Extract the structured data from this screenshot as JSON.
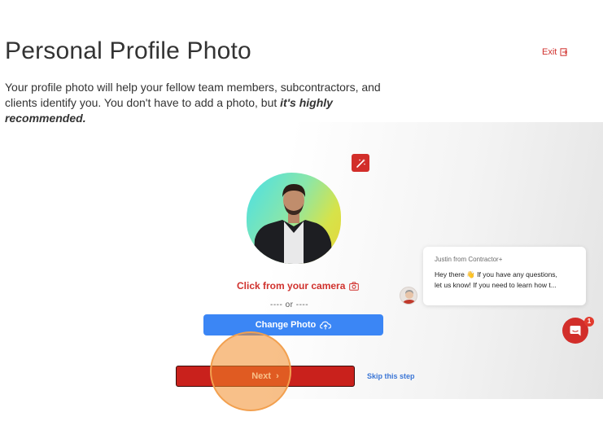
{
  "header": {
    "title": "Personal Profile Photo",
    "exit_label": "Exit"
  },
  "intro": {
    "text": "Your profile photo will help your fellow team members, subcontractors, and clients identify you. You don't have to add a photo, but ",
    "emphasis": "it's highly recommended."
  },
  "photo": {
    "edit_icon": "magic-wand-icon"
  },
  "actions": {
    "camera_label": "Click from your camera",
    "or_divider": "---- or ----",
    "change_photo_label": "Change Photo",
    "next_label": "Next",
    "skip_label": "Skip this step"
  },
  "chat": {
    "from": "Justin from Contractor+",
    "message_line1": "Hey there 👋 If you have any questions,",
    "message_line2": "let us know! If you need to learn how t...",
    "badge_count": "1"
  },
  "colors": {
    "brand_red": "#d0312d",
    "primary_blue": "#3b86f5",
    "next_red": "#c9211c"
  }
}
